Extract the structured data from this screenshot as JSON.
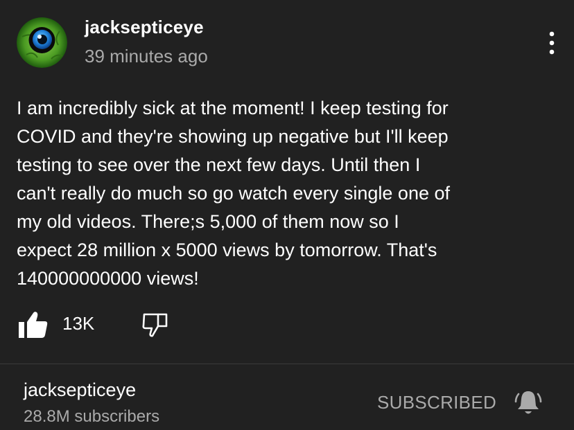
{
  "post": {
    "author": "jacksepticeye",
    "time": "39 minutes ago",
    "avatar_icon": "septic-eye-avatar-icon",
    "menu_icon": "more-vertical-icon",
    "text": "I am incredibly sick at the moment! I keep testing for\nCOVID and they're showing up negative but I'll keep\ntesting to see over the next few days. Until then I\ncan't really do much so go watch every single one of\nmy old videos. There;s 5,000 of them now so I\nexpect 28 million x 5000 views by tomorrow. That's\n140000000000 views!",
    "actions": {
      "like_icon": "thumbs-up-icon",
      "like_count": "13K",
      "dislike_icon": "thumbs-down-icon"
    }
  },
  "channel": {
    "name": "jacksepticeye",
    "subscribers": "28.8M subscribers",
    "subscribe_label": "SUBSCRIBED",
    "bell_icon": "notification-bell-icon"
  },
  "colors": {
    "background": "#212121",
    "primary_text": "#ffffff",
    "secondary_text": "#aaaaaa",
    "divider": "#3a3a3a"
  }
}
